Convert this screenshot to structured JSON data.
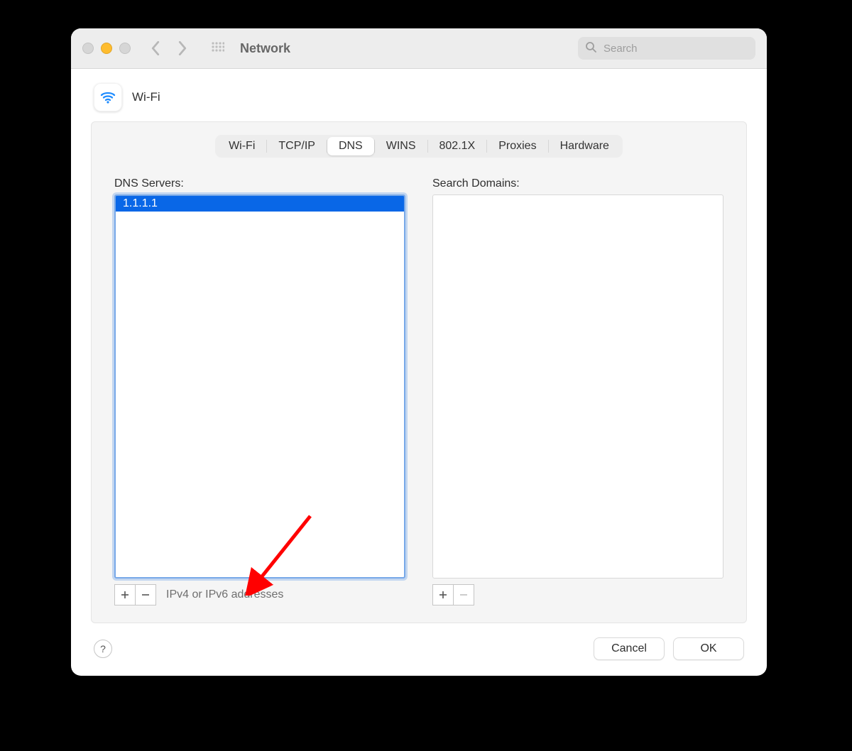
{
  "window": {
    "title": "Network",
    "search_placeholder": "Search"
  },
  "interface": {
    "label": "Wi-Fi"
  },
  "tabs": {
    "items": [
      "Wi-Fi",
      "TCP/IP",
      "DNS",
      "WINS",
      "802.1X",
      "Proxies",
      "Hardware"
    ],
    "active_index": 2
  },
  "dns": {
    "servers_label": "DNS Servers:",
    "servers": [
      "1.1.1.1"
    ],
    "hint": "IPv4 or IPv6 addresses"
  },
  "search_domains": {
    "label": "Search Domains:",
    "items": []
  },
  "buttons": {
    "cancel": "Cancel",
    "ok": "OK",
    "help": "?"
  }
}
